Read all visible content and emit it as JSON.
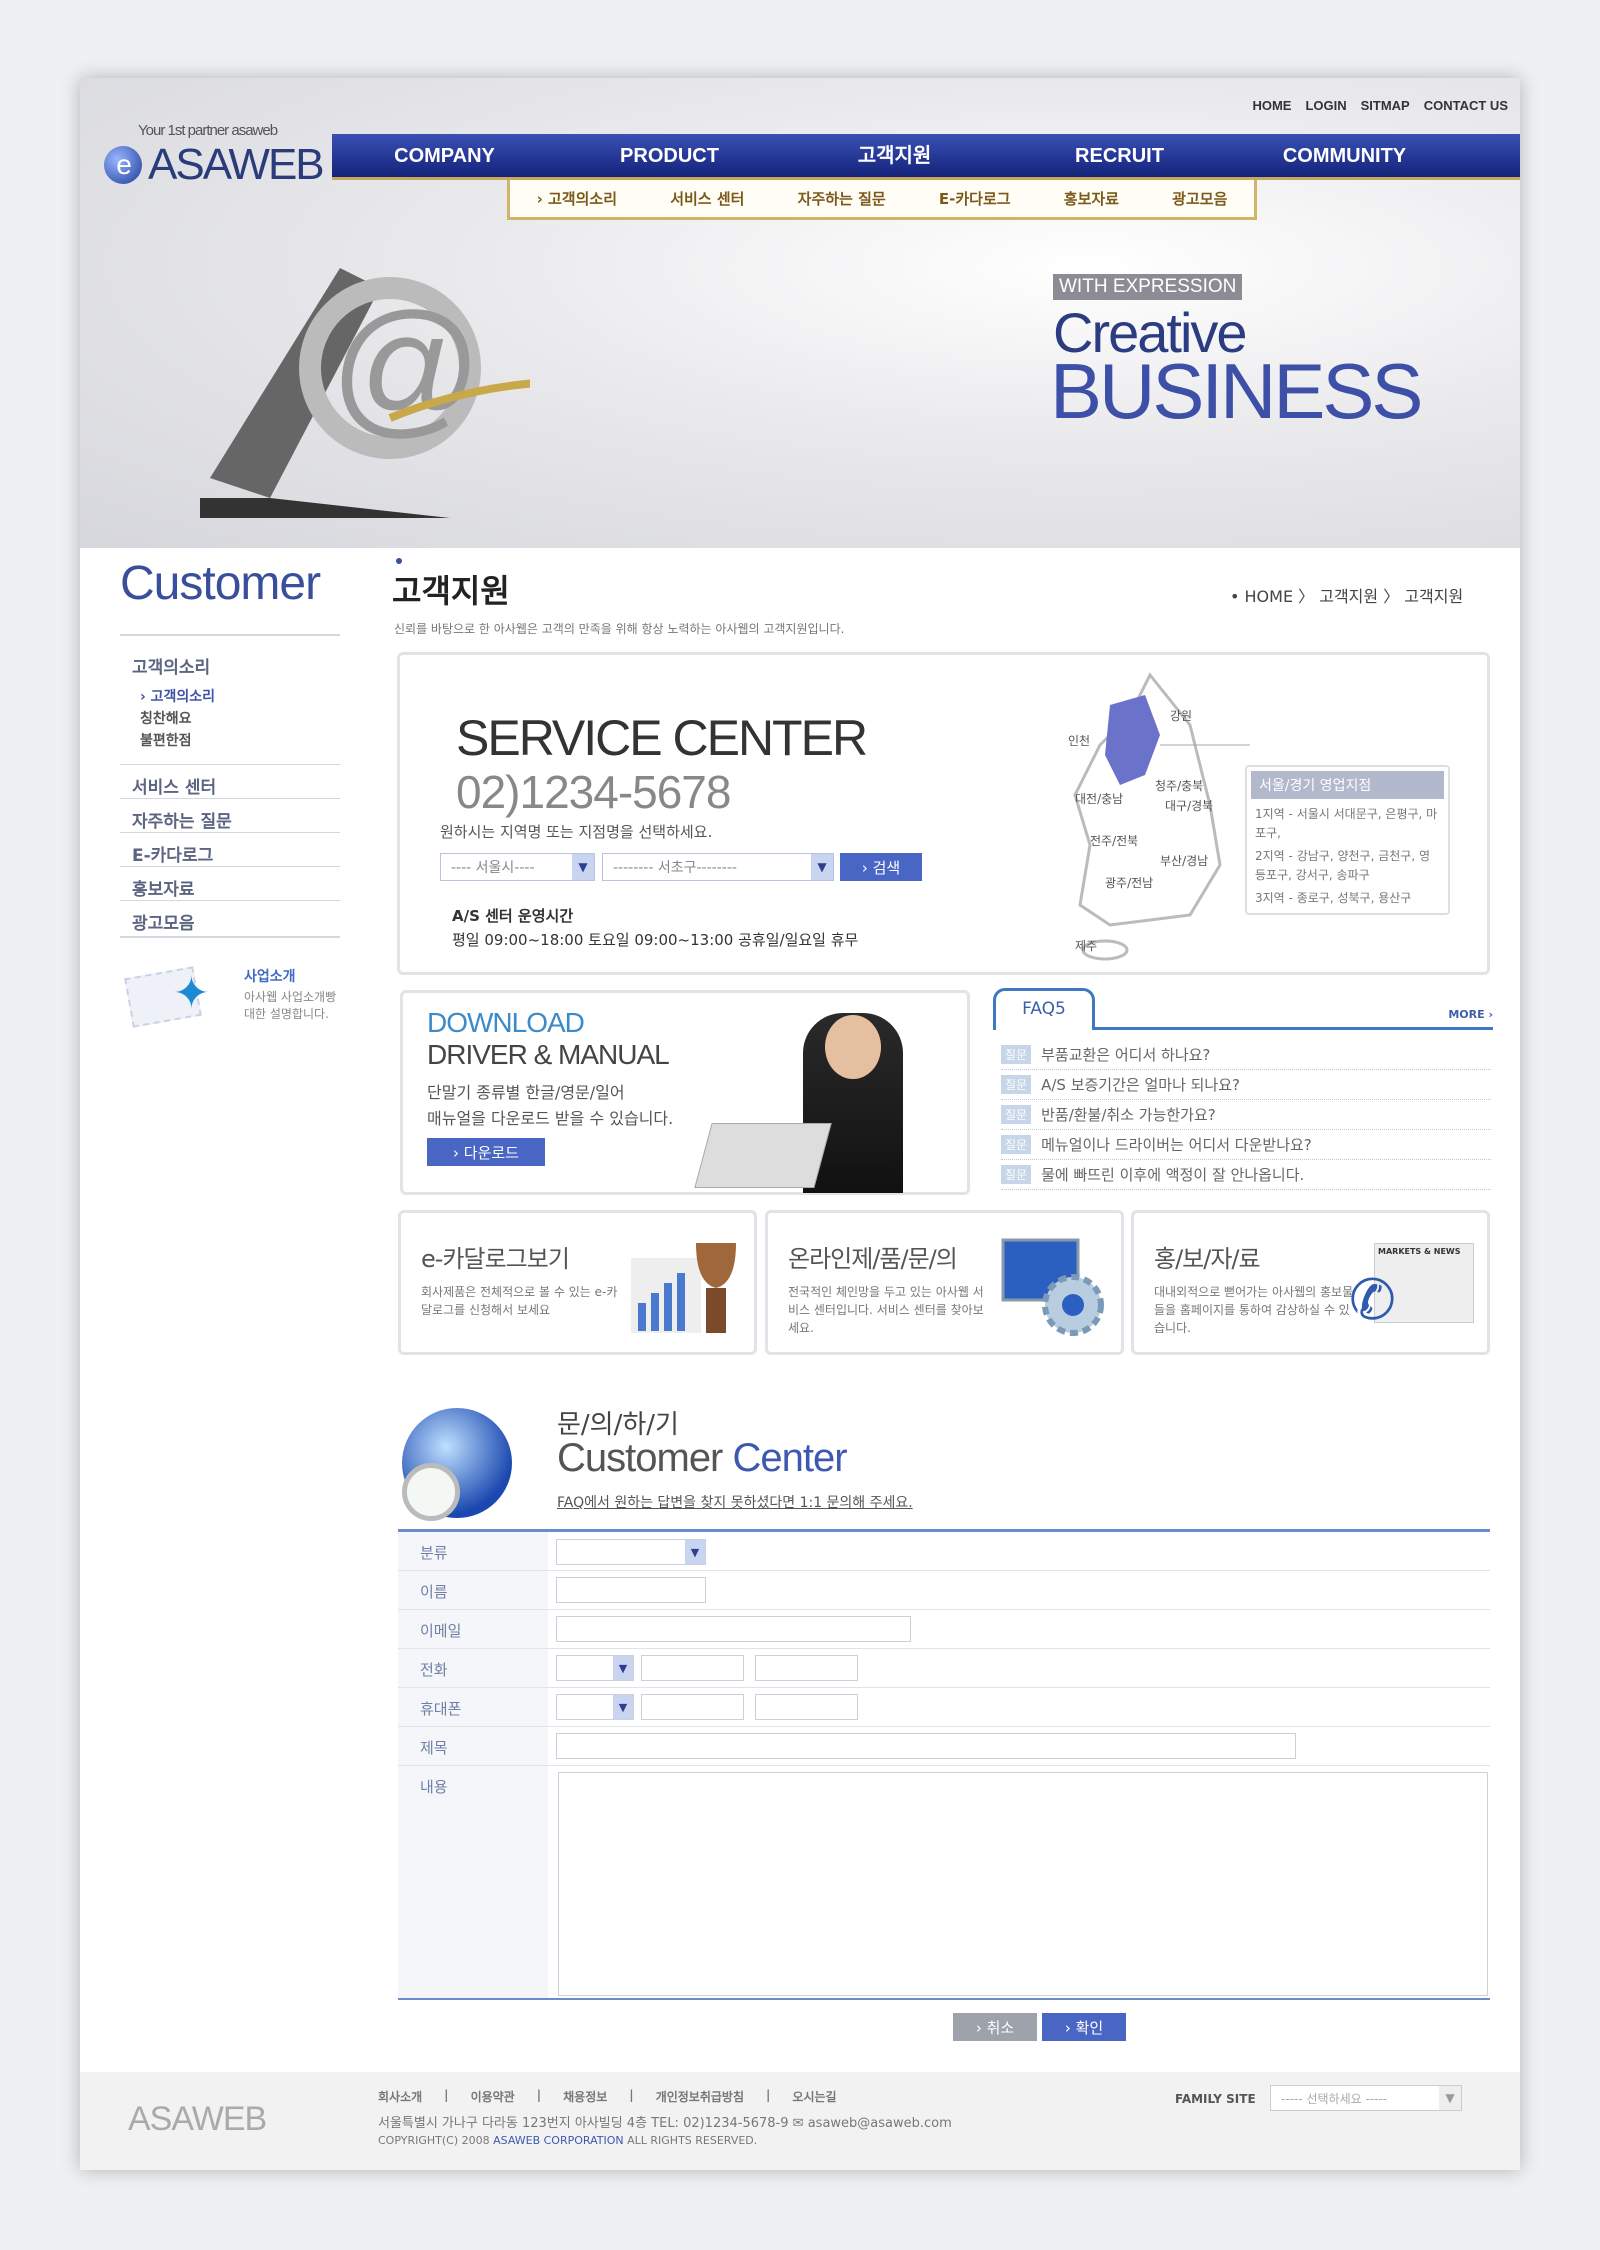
{
  "top_links": [
    "HOME",
    "LOGIN",
    "SITMAP",
    "CONTACT US"
  ],
  "brand": {
    "tagline": "Your 1st partner asaweb",
    "name": "ASAWEB",
    "logo_letter": "e"
  },
  "nav": [
    "COMPANY",
    "PRODUCT",
    "고객지원",
    "RECRUIT",
    "COMMUNITY"
  ],
  "subnav": [
    "› 고객의소리",
    "서비스 센터",
    "자주하는 질문",
    "E-카다로그",
    "홍보자료",
    "광고모음"
  ],
  "hero": {
    "label": "WITH EXPRESSION",
    "line1": "Creative",
    "line2": "BUSINESS"
  },
  "sidebar": {
    "title": "Customer",
    "group": "고객의소리",
    "subitems": [
      "› 고객의소리",
      "칭찬해요",
      "불편한점"
    ],
    "items": [
      "서비스 센터",
      "자주하는 질문",
      "E-카다로그",
      "홍보자료",
      "광고모음"
    ],
    "promo": {
      "title": "사업소개",
      "text1": "아사웹 사업소개빵",
      "text2": "대한 설명합니다."
    }
  },
  "page": {
    "title": "고객지원",
    "breadcrumb": "• HOME 〉 고객지원 〉 고객지원",
    "subtitle": "신뢰를 바탕으로 한 아사웹은 고객의 만족을 위해 항상 노력하는 아사웹의 고객지원입니다."
  },
  "service": {
    "title": "SERVICE CENTER",
    "phone": "02)1234-5678",
    "prompt": "원하시는 지역명 또는 지점명을 선택하세요.",
    "city": "---- 서울시----",
    "district": "-------- 서초구--------",
    "search": "› 검색",
    "hours_title": "A/S 센터 운영시간",
    "hours": "평일 09:00~18:00 토요일 09:00~13:00 공휴일/일요일 휴무",
    "map_labels": [
      "인천",
      "강원",
      "청주/충북",
      "대전/충남",
      "대구/경북",
      "전주/전북",
      "부산/경남",
      "광주/전남",
      "제주"
    ],
    "branch": {
      "title": "서울/경기 영업지점",
      "rows": [
        [
          "1지역 -",
          "서울시 서대문구, 은평구, 마포구,"
        ],
        [
          "2지역 -",
          "강남구, 양천구, 금천구, 영등포구, 강서구, 송파구"
        ],
        [
          "3지역 -",
          "종로구, 성북구, 용산구"
        ]
      ]
    },
    "highlight_color": "#6a72c9"
  },
  "download": {
    "title1": "DOWNLOAD",
    "title2": "DRIVER & MANUAL",
    "text1": "단말기 종류별 한글/영문/일어",
    "text2": "매뉴얼을 다운로드 받을 수 있습니다.",
    "button": "› 다운로드"
  },
  "faq": {
    "tab": "FAQ5",
    "more": "MORE ›",
    "tag": "질문",
    "items": [
      "부품교환은 어디서 하나요?",
      "A/S 보증기간은 얼마나 되나요?",
      "반품/환불/취소 가능한가요?",
      "메뉴얼이나 드라이버는 어디서 다운받나요?",
      "물에 빠뜨린 이후에 액정이 잘 안나옵니다."
    ]
  },
  "cards": [
    {
      "title": "e-카달로그보기",
      "text": "회사제품은 전체적으로 볼 수 있는 e-카달로그를 신청해서 보세요",
      "icon": "trophy-chart-icon"
    },
    {
      "title": "온라인제/품/문/의",
      "text": "전국적인 체인망을 두고 있는 아사웹 서비스 센터입니다. 서비스 센터를 찾아보세요.",
      "icon": "monitor-gear-icon"
    },
    {
      "title": "홍/보/자/료",
      "text": "대내외적으로 뻗어가는 아사웹의 홍보물들을 홈페이지를 통하여 감상하실 수 있습니다.",
      "icon": "phone-newspaper-icon",
      "news": "MARKETS & NEWS"
    }
  ],
  "contact": {
    "kicker": "문/의/하/기",
    "title_a": "Customer",
    "title_b": "Center",
    "subtitle": "FAQ에서 원하는 답변을 찾지 못하셨다면 1:1 문의해 주세요."
  },
  "form": {
    "labels": [
      "분류",
      "이름",
      "이메일",
      "전화",
      "휴대폰",
      "제목",
      "내용"
    ],
    "cancel": "› 취소",
    "ok": "› 확인"
  },
  "footer": {
    "brand": "ASAWEB",
    "links": [
      "회사소개",
      "이용약관",
      "채용정보",
      "개인정보취급방침",
      "오시는길"
    ],
    "address": "서울특별시 가나구 다라동 123번지 아사빌딩 4층 TEL: 02)1234-5678-9",
    "email": "asaweb@asaweb.com",
    "copy_a": "COPYRIGHT(C) 2008",
    "copy_b": "ASAWEB CORPORATION",
    "copy_c": "ALL RIGHTS RESERVED.",
    "family_label": "FAMILY SITE",
    "family_select": "----- 선택하세요 -----"
  },
  "colors": {
    "nav": "#1c2f8a",
    "accent": "#4a66c4",
    "gold": "#d1b467"
  }
}
